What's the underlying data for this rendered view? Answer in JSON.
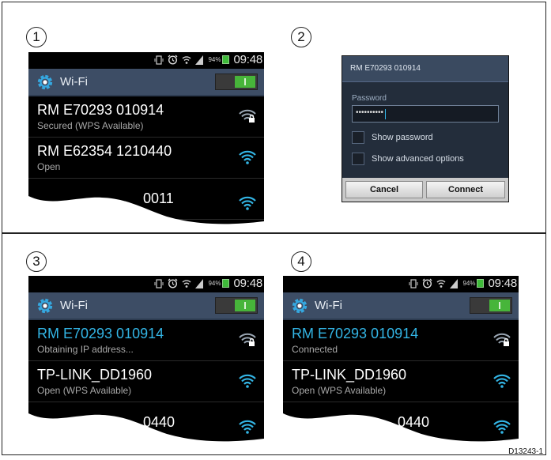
{
  "steps": [
    "1",
    "2",
    "3",
    "4"
  ],
  "status_bar": {
    "battery_pct": "94%",
    "time": "09:48"
  },
  "wifi_header": {
    "title": "Wi-Fi"
  },
  "panel1": {
    "networks": [
      {
        "name": "RM E70293 010914",
        "status": "Secured (WPS Available)",
        "icon": "wifi-locked-icon"
      },
      {
        "name": "RM E62354 1210440",
        "status": "Open",
        "icon": "wifi-icon"
      },
      {
        "name": "0011",
        "status": "",
        "icon": "wifi-icon"
      }
    ]
  },
  "dialog": {
    "title": "RM E70293 010914",
    "password_label": "Password",
    "password_value": "••••••••••",
    "show_password_label": "Show password",
    "show_advanced_label": "Show advanced options",
    "cancel_label": "Cancel",
    "connect_label": "Connect"
  },
  "panel3": {
    "networks": [
      {
        "name": "RM E70293 010914",
        "status": "Obtaining IP address...",
        "icon": "wifi-locked-icon"
      },
      {
        "name": "TP-LINK_DD1960",
        "status": "Open (WPS Available)",
        "icon": "wifi-icon"
      },
      {
        "name": "0440",
        "status": "",
        "icon": "wifi-icon"
      }
    ]
  },
  "panel4": {
    "networks": [
      {
        "name": "RM E70293 010914",
        "status": "Connected",
        "icon": "wifi-locked-icon"
      },
      {
        "name": "TP-LINK_DD1960",
        "status": "Open (WPS Available)",
        "icon": "wifi-icon"
      },
      {
        "name": "0440",
        "status": "",
        "icon": "wifi-icon"
      }
    ]
  },
  "figure_code": "D13243-1",
  "colors": {
    "accent": "#33b5e5",
    "header": "#3d4d65",
    "toggle_on": "#47b53a"
  }
}
